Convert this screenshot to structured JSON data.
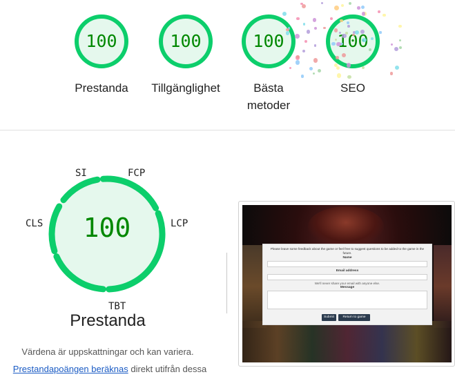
{
  "summary": {
    "items": [
      {
        "score": "100",
        "label": "Prestanda"
      },
      {
        "score": "100",
        "label": "Tillgänglighet"
      },
      {
        "score": "100",
        "label": "Bästa metoder"
      },
      {
        "score": "100",
        "label": "SEO"
      }
    ]
  },
  "performance": {
    "score": "100",
    "title": "Prestanda",
    "metrics": {
      "si": "SI",
      "fcp": "FCP",
      "lcp": "LCP",
      "tbt": "TBT",
      "cls": "CLS"
    },
    "note": "Värdena är uppskattningar och kan variera.",
    "calc_link": "Prestandapoängen beräknas",
    "calc_rest": " direkt utifrån dessa"
  },
  "colors": {
    "pass_green": "#0cce6b",
    "pass_fill": "#e5f8ed",
    "pass_text": "#008800",
    "link": "#1a5bc4"
  },
  "screenshot": {
    "intro": "Please leave some feedback about the game or feel free to suggest questions to be added to the game in the future.",
    "name_label": "Name",
    "email_label": "Email address",
    "email_hint": "We'll never share your email with anyone else.",
    "message_label": "Message",
    "submit_label": "Submit",
    "return_label": "Return to game"
  }
}
